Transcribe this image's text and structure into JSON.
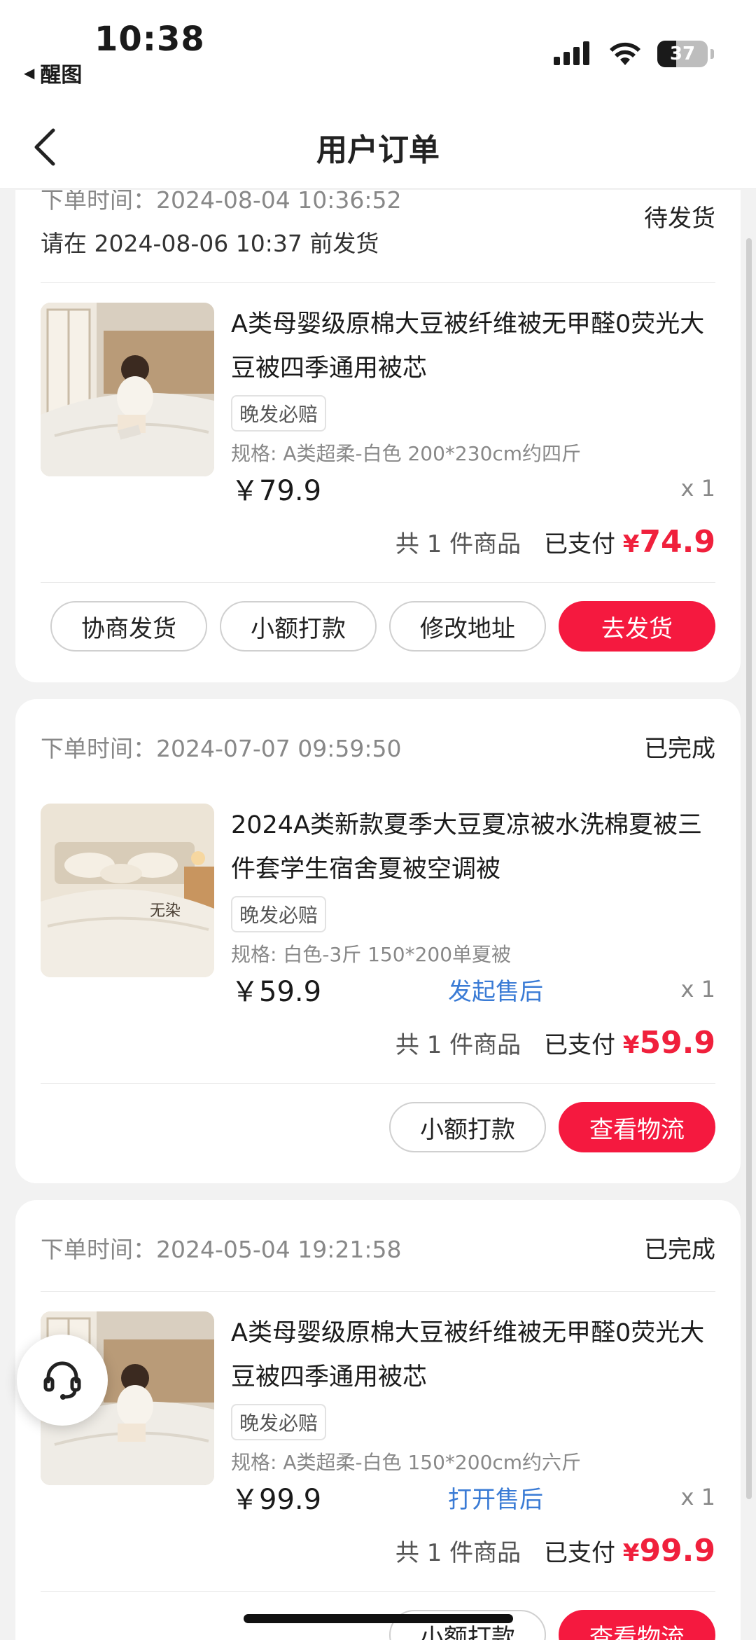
{
  "status_bar": {
    "time": "10:38",
    "back_app": "醒图",
    "battery": "37",
    "battery_level_percent": 37
  },
  "nav": {
    "title": "用户订单"
  },
  "orders": [
    {
      "order_time_label": "下单时间：",
      "order_time": "2024-08-04 10:36:52",
      "deadline": "请在 2024-08-06 10:37 前发货",
      "status": "待发货",
      "product_title": "A类母婴级原棉大豆被纤维被无甲醛0荧光大豆被四季通用被芯",
      "tag": "晚发必赔",
      "spec": "规格: A类超柔-白色 200*230cm约四斤",
      "price": "￥79.9",
      "after_sale": "",
      "qty": "x 1",
      "summary_count": "共 1 件商品",
      "paid_label": "已支付",
      "paid_currency": "¥",
      "paid_amount": "74.9",
      "buttons": [
        "协商发货",
        "小额打款",
        "修改地址",
        "去发货"
      ]
    },
    {
      "order_time_label": "下单时间：",
      "order_time": "2024-07-07 09:59:50",
      "deadline": "",
      "status": "已完成",
      "product_title": "2024A类新款夏季大豆夏凉被水洗棉夏被三件套学生宿舍夏被空调被",
      "tag": "晚发必赔",
      "spec": "规格: 白色-3斤 150*200单夏被",
      "price": "￥59.9",
      "after_sale": "发起售后",
      "qty": "x 1",
      "summary_count": "共 1 件商品",
      "paid_label": "已支付",
      "paid_currency": "¥",
      "paid_amount": "59.9",
      "buttons": [
        "小额打款",
        "查看物流"
      ]
    },
    {
      "order_time_label": "下单时间：",
      "order_time": "2024-05-04 19:21:58",
      "deadline": "",
      "status": "已完成",
      "product_title": "A类母婴级原棉大豆被纤维被无甲醛0荧光大豆被四季通用被芯",
      "tag": "晚发必赔",
      "spec": "规格: A类超柔-白色 150*200cm约六斤",
      "price": "￥99.9",
      "after_sale": "打开售后",
      "qty": "x 1",
      "summary_count": "共 1 件商品",
      "paid_label": "已支付",
      "paid_currency": "¥",
      "paid_amount": "99.9",
      "buttons": [
        "小额打款",
        "查看物流"
      ]
    }
  ],
  "product_image_2_text": "无染",
  "colors": {
    "accent": "#f5193f",
    "price_red": "#f0203c",
    "link_blue": "#3a7bd5"
  },
  "icons": [
    "signal-icon",
    "wifi-icon",
    "battery-icon",
    "back-chevron-icon",
    "customer-service-icon"
  ]
}
